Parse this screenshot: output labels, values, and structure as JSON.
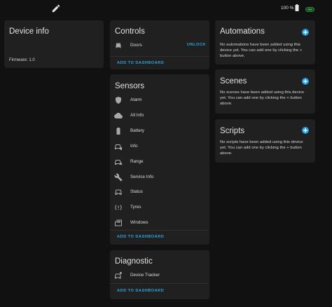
{
  "header": {
    "battery_text": "100 %",
    "edit_icon": "pencil-icon",
    "battery_icon": "battery-full-icon",
    "car_icon": "car-badge-icon"
  },
  "device_info": {
    "title": "Device info",
    "firmware": "Firmware: 1.0"
  },
  "controls": {
    "title": "Controls",
    "items": [
      {
        "label": "Doors",
        "icon": "car-door-icon",
        "action": "UNLOCK"
      }
    ],
    "add_to_dashboard": "ADD TO DASHBOARD"
  },
  "sensors": {
    "title": "Sensors",
    "items": [
      {
        "label": "Alarm",
        "icon": "shield-icon"
      },
      {
        "label": "All Info",
        "icon": "cloud-icon"
      },
      {
        "label": "Battery",
        "icon": "car-battery-icon"
      },
      {
        "label": "Info",
        "icon": "car-info-icon"
      },
      {
        "label": "Range",
        "icon": "car-range-icon"
      },
      {
        "label": "Service Info",
        "icon": "wrench-icon"
      },
      {
        "label": "Status",
        "icon": "car-status-icon"
      },
      {
        "label": "Tyres",
        "icon": "tire-pressure-icon"
      },
      {
        "label": "Windows",
        "icon": "car-window-icon"
      }
    ],
    "add_to_dashboard": "ADD TO DASHBOARD"
  },
  "diagnostic": {
    "title": "Diagnostic",
    "items": [
      {
        "label": "Device Tracker",
        "icon": "car-tracker-icon"
      }
    ],
    "add_to_dashboard": "ADD TO DASHBOARD"
  },
  "automations": {
    "title": "Automations",
    "description": "No automations have been added using this device yet. You can add one by clicking the + button above."
  },
  "scenes": {
    "title": "Scenes",
    "description": "No scenes have been added using this device yet. You can add one by clicking the + button above."
  },
  "scripts": {
    "title": "Scripts",
    "description": "No scripts have been added using this device yet. You can add one by clicking the + button above."
  },
  "colors": {
    "accent": "#2ea4e0",
    "card": "#202020",
    "background": "#111111",
    "icon": "#a9a9a9",
    "battery_badge": "#3aa84a"
  }
}
